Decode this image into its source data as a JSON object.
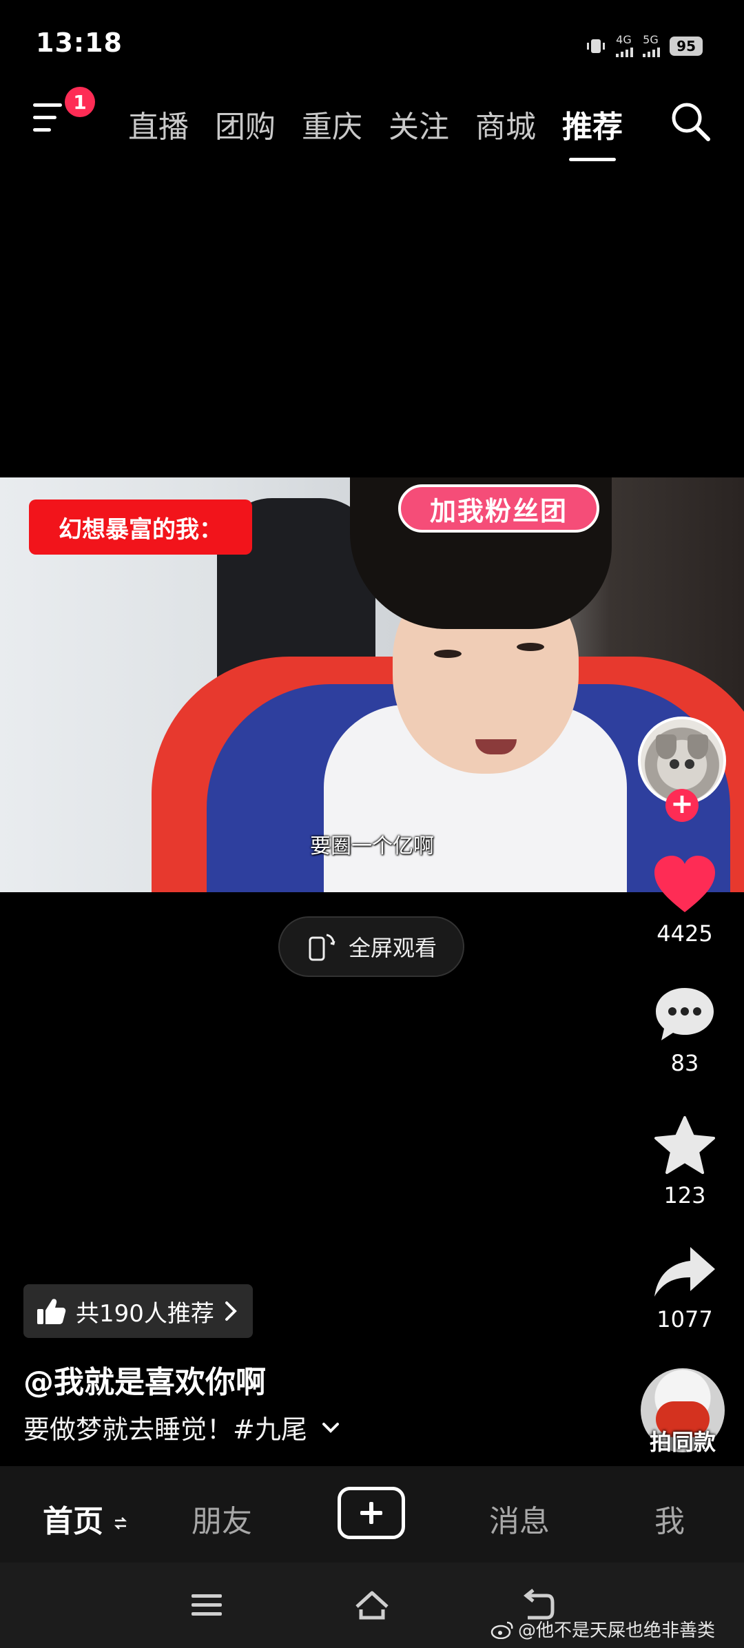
{
  "status_bar": {
    "time": "13:18",
    "network_1": "4G",
    "network_2": "5G",
    "battery": "95"
  },
  "top_nav": {
    "menu_badge": "1",
    "tabs": [
      {
        "label": "直播"
      },
      {
        "label": "团购"
      },
      {
        "label": "重庆"
      },
      {
        "label": "关注"
      },
      {
        "label": "商城"
      },
      {
        "label": "推荐"
      }
    ],
    "active_tab": "推荐"
  },
  "video": {
    "caption": "幻想暴富的我：",
    "headband_text": "加我粉丝团",
    "subtitle": "要圈一个亿啊",
    "fullscreen_label": "全屏观看"
  },
  "actions": {
    "likes": "4425",
    "comments": "83",
    "favorites": "123",
    "shares": "1077",
    "same_style_label": "拍同款"
  },
  "post": {
    "recommend_text": "共190人推荐",
    "author": "@我就是喜欢你啊",
    "description": "要做梦就去睡觉！#九尾"
  },
  "bottom_tabs": {
    "home": "首页",
    "friends": "朋友",
    "messages": "消息",
    "me": "我"
  },
  "watermark": "@他不是天屎也绝非善类",
  "colors": {
    "accent": "#fe2c55",
    "caption_bg": "#f2141b",
    "background": "#000000"
  }
}
